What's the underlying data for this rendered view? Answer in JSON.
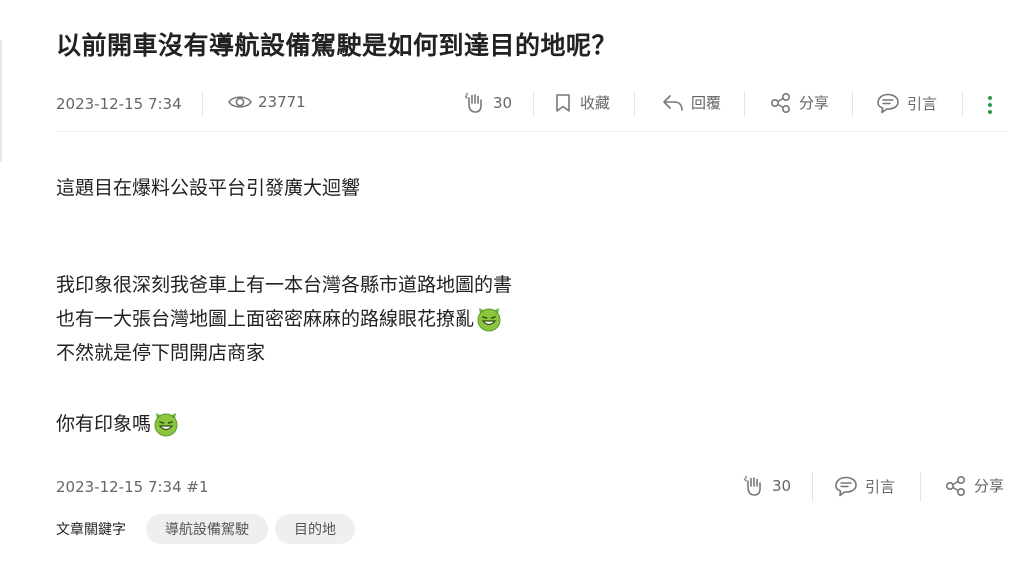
{
  "post": {
    "title": "以前開車沒有導航設備駕駛是如何到達目的地呢？",
    "date": "2023-12-15 7:34",
    "views": "23771",
    "likes": "30",
    "bookmark_label": "收藏",
    "reply_label": "回覆",
    "share_label": "分享",
    "quote_label": "引言"
  },
  "body": {
    "line1": "這題目在爆料公設平台引發廣大迴響",
    "line2": "我印象很深刻我爸車上有一本台灣各縣市道路地圖的書",
    "line3": "也有一大張台灣地圖上面密密麻麻的路線眼花撩亂",
    "line4": "不然就是停下問開店商家",
    "line5": "你有印象嗎"
  },
  "footer": {
    "floor": "2023-12-15 7:34 #1",
    "likes": "30",
    "quote_label": "引言",
    "share_label": "分享"
  },
  "keywords": {
    "label": "文章關鍵字",
    "tags": [
      "導航設備駕駛",
      "目的地"
    ]
  },
  "colors": {
    "accent": "#2f9a4a",
    "icon": "#666666",
    "tag_bg": "#efefef"
  },
  "icons": [
    "eye-icon",
    "clap-icon",
    "bookmark-icon",
    "reply-icon",
    "share-icon",
    "quote-icon",
    "more-vertical-icon",
    "grinning-devil-emoji"
  ]
}
